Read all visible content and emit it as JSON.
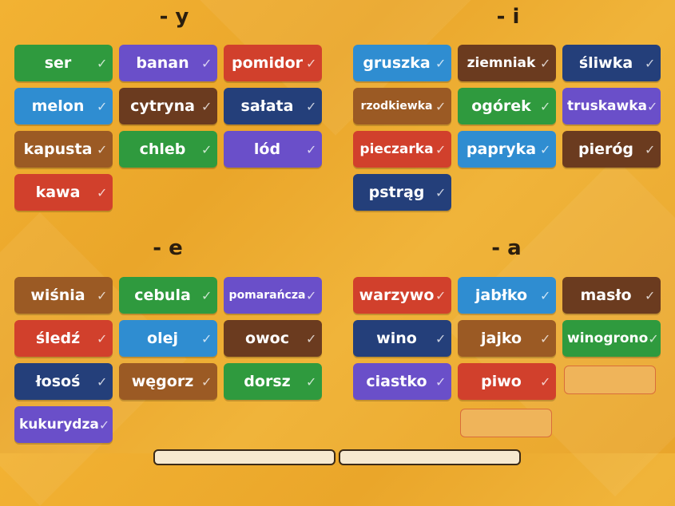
{
  "colors": {
    "green": "#2f9a3e",
    "purple": "#6a4fc9",
    "red": "#d1402c",
    "blue": "#2f8dd1",
    "brown": "#6b3b1f",
    "navy": "#243f7a",
    "tan": "#9b5a24"
  },
  "groups": [
    {
      "title": "- y",
      "tiles": [
        {
          "label": "ser",
          "color": "green"
        },
        {
          "label": "banan",
          "color": "purple"
        },
        {
          "label": "pomidor",
          "color": "red"
        },
        {
          "label": "melon",
          "color": "blue"
        },
        {
          "label": "cytryna",
          "color": "brown"
        },
        {
          "label": "sałata",
          "color": "navy"
        },
        {
          "label": "kapusta",
          "color": "tan"
        },
        {
          "label": "chleb",
          "color": "green"
        },
        {
          "label": "lód",
          "color": "purple"
        },
        {
          "label": "kawa",
          "color": "red"
        }
      ]
    },
    {
      "title": "- i",
      "tiles": [
        {
          "label": "gruszka",
          "color": "blue"
        },
        {
          "label": "ziemniak",
          "color": "brown"
        },
        {
          "label": "śliwka",
          "color": "navy"
        },
        {
          "label": "rzodkiewka",
          "color": "tan"
        },
        {
          "label": "ogórek",
          "color": "green"
        },
        {
          "label": "truskawka",
          "color": "purple"
        },
        {
          "label": "pieczarka",
          "color": "red"
        },
        {
          "label": "papryka",
          "color": "blue"
        },
        {
          "label": "pieróg",
          "color": "brown"
        },
        {
          "label": "pstrąg",
          "color": "navy"
        }
      ]
    },
    {
      "title": "- e",
      "tiles": [
        {
          "label": "wiśnia",
          "color": "tan"
        },
        {
          "label": "cebula",
          "color": "green"
        },
        {
          "label": "pomarańcza",
          "color": "purple"
        },
        {
          "label": "śledź",
          "color": "red"
        },
        {
          "label": "olej",
          "color": "blue"
        },
        {
          "label": "owoc",
          "color": "brown"
        },
        {
          "label": "łosoś",
          "color": "navy"
        },
        {
          "label": "węgorz",
          "color": "tan"
        },
        {
          "label": "dorsz",
          "color": "green"
        },
        {
          "label": "kukurydza",
          "color": "purple"
        }
      ]
    },
    {
      "title": "- a",
      "tiles": [
        {
          "label": "warzywo",
          "color": "red"
        },
        {
          "label": "jabłko",
          "color": "blue"
        },
        {
          "label": "masło",
          "color": "brown"
        },
        {
          "label": "wino",
          "color": "navy"
        },
        {
          "label": "jajko",
          "color": "tan"
        },
        {
          "label": "winogrono",
          "color": "green"
        },
        {
          "label": "ciastko",
          "color": "purple"
        },
        {
          "label": "piwo",
          "color": "red"
        }
      ]
    }
  ],
  "check_icon": "check-icon",
  "check_glyph": "✓"
}
